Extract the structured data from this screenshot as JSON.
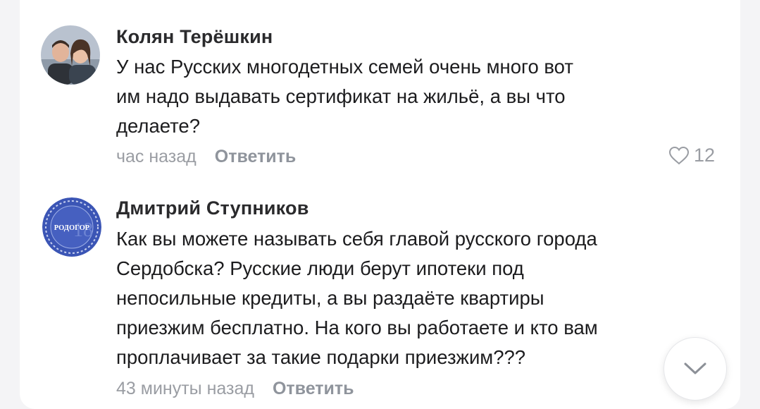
{
  "comments": [
    {
      "author": "Колян Терёшкин",
      "line1": "У нас Русских многодетных семей очень много вот",
      "line2": "им надо выдавать сертификат на жильё, а вы что",
      "line3": "делаете?",
      "time": "час назад",
      "reply_label": "Ответить",
      "likes": "12",
      "avatar_icon": "couple-photo"
    },
    {
      "author": "Дмитрий Ступников",
      "line1": "Как вы можете называть себя главой русского города",
      "line2": "Сердобска? Русские люди берут ипотеки под",
      "line3": "непосильные кредиты, а вы раздаёте квартиры",
      "line4": "приезжим бесплатно. На кого вы работаете и кто вам",
      "line5": "проплачивает за такие подарки приезжим???",
      "time": "43 минуты назад",
      "reply_label": "Ответить",
      "avatar_logo_text": "РОДОГОР",
      "avatar_icon": "rodogor-logo"
    }
  ],
  "icons": {
    "like": "heart-outline-icon",
    "scroll": "chevron-down-icon"
  },
  "colors": {
    "card": "#ffffff",
    "background": "#f4f4f6",
    "meta_text": "#9a9da3",
    "logo_blue": "#3b55b5"
  }
}
